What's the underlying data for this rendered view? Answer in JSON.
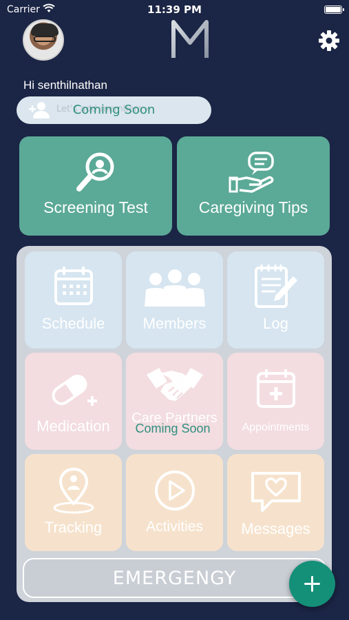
{
  "status_bar": {
    "carrier": "Carrier",
    "time": "11:39 PM"
  },
  "header": {
    "greeting": "Hi senthilnathan",
    "logo_letter": "M"
  },
  "invite": {
    "label": "Let's add members »",
    "overlay": "Coming Soon"
  },
  "top_tiles": [
    {
      "label": "Screening Test",
      "icon": "magnifier-person-icon"
    },
    {
      "label": "Caregiving Tips",
      "icon": "hand-speech-bubble-icon"
    }
  ],
  "grid": [
    {
      "label": "Schedule",
      "icon": "calendar-icon"
    },
    {
      "label": "Members",
      "icon": "people-group-icon"
    },
    {
      "label": "Log",
      "icon": "notepad-pen-icon"
    },
    {
      "label": "Medication",
      "icon": "pill-icon"
    },
    {
      "label": "Care Partners",
      "icon": "handshake-icon"
    },
    {
      "label": "Appointments",
      "icon": "calendar-plus-icon"
    },
    {
      "label": "Tracking",
      "icon": "location-pin-icon"
    },
    {
      "label": "Activities",
      "icon": "play-circle-icon"
    },
    {
      "label": "Messages",
      "icon": "chat-heart-icon"
    }
  ],
  "care_partners_overlay": "Coming Soon",
  "emergency_label": "EMERGENGY",
  "colors": {
    "background": "#1b2545",
    "accent": "#5ba997",
    "fab": "#148f78",
    "blue_tile": "#d6e5f0",
    "pink_tile": "#f3dde1",
    "peach_tile": "#f6e2cc"
  }
}
